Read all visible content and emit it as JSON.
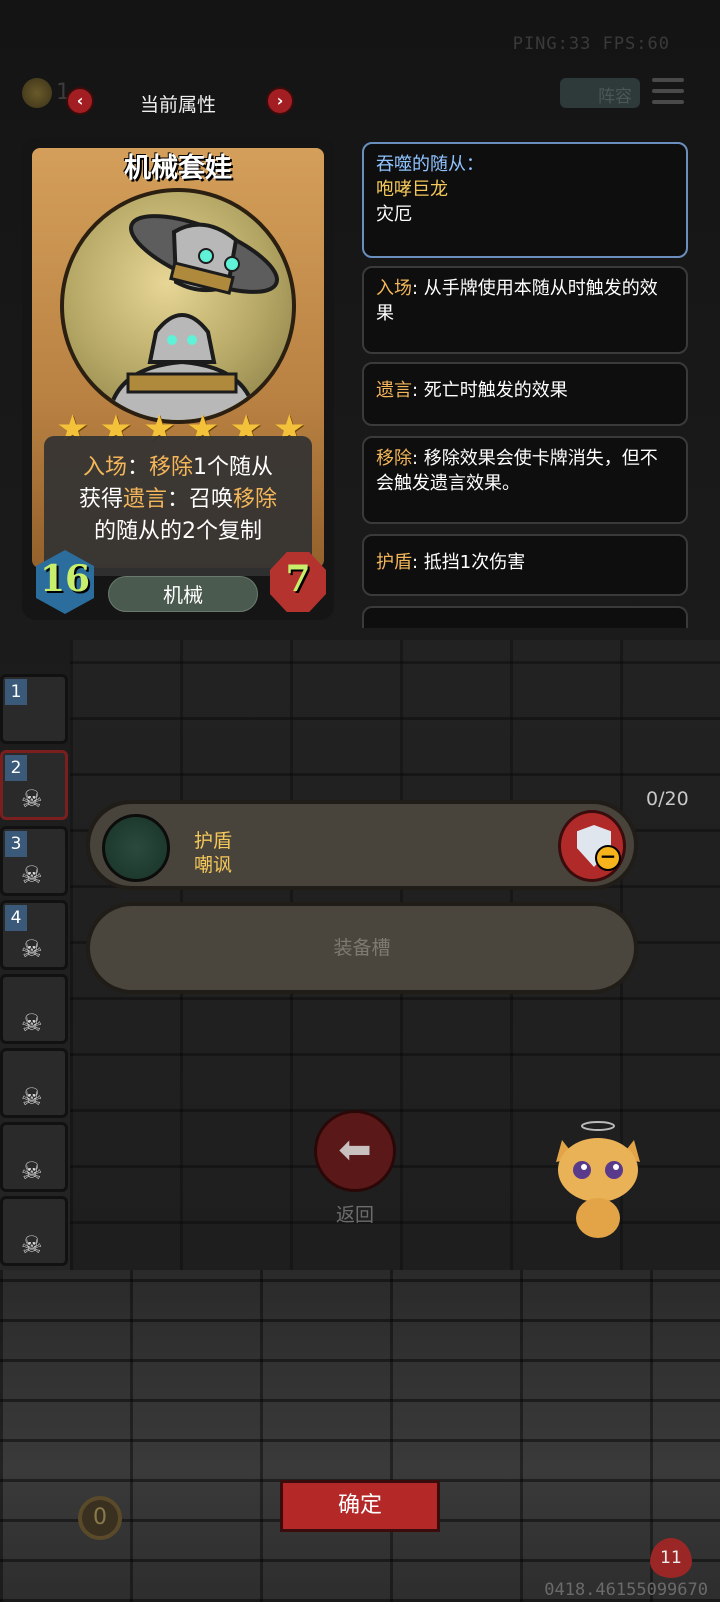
{
  "hud": {
    "ping_fps": "PING:33   FPS:60",
    "coins": "1",
    "lineup_label": "阵容"
  },
  "nav": {
    "title": "当前属性",
    "prev": "‹",
    "next": "›"
  },
  "card": {
    "name": "机械套娃",
    "stars": 6,
    "desc_line1_a": "入场",
    "desc_line1_b": "：",
    "desc_line1_c": "移除",
    "desc_line1_d": "1个随从",
    "desc_line2_a": "获得",
    "desc_line2_b": "遗言",
    "desc_line2_c": "：召唤",
    "desc_line2_d": "移除",
    "desc_line3": "的随从的2个复制",
    "attack": "16",
    "health": "7",
    "tribe": "机械"
  },
  "keywords": {
    "devour_title": "吞噬的随从：",
    "devour_item1": "咆哮巨龙",
    "devour_item2": "灾厄",
    "battlecry_key": "入场",
    "battlecry_desc": ": 从手牌使用本随从时触发的效果",
    "deathrattle_key": "遗言",
    "deathrattle_desc": ": 死亡时触发的效果",
    "remove_key": "移除",
    "remove_desc": ": 移除效果会使卡牌消失，但不会触发遗言效果。",
    "shield_key": "护盾",
    "shield_desc": ": 抵挡1次伤害"
  },
  "bench": [
    "1",
    "2",
    "3",
    "4"
  ],
  "counter": "0/20",
  "popup": {
    "line1": "护盾",
    "line2": "嘲讽",
    "equip_slot": "装备槽"
  },
  "back_label": "返回",
  "confirm_label": "确定",
  "gold_count": "0",
  "hero_health": "11",
  "id_text": "0418.46155099670"
}
